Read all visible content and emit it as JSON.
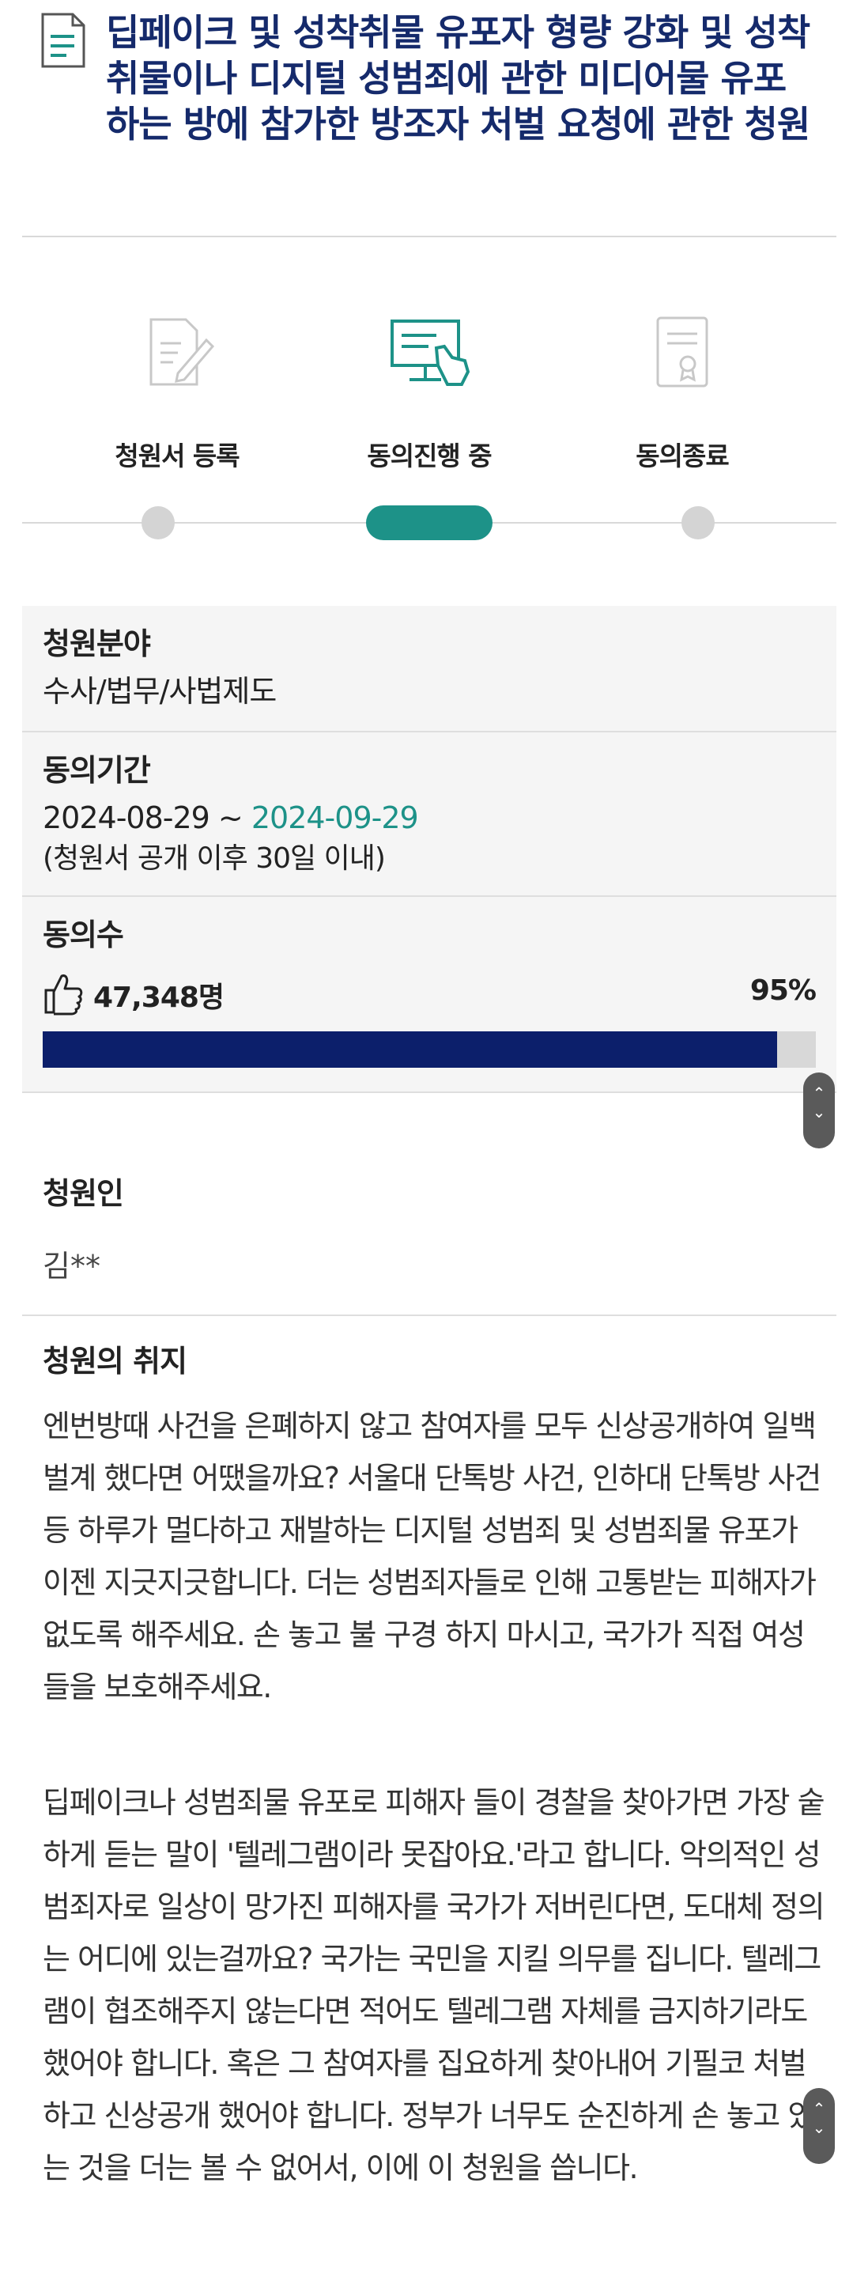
{
  "petition": {
    "title": "딥페이크 및 성착취물 유포자 형량 강화 및 성착취물이나 디지털 성범죄에 관한 미디어물 유포하는 방에 참가한 방조자 처벌 요청에 관한 청원"
  },
  "steps": [
    {
      "label": "청원서 등록",
      "icon": "pen-document-icon",
      "active": false
    },
    {
      "label": "동의진행 중",
      "icon": "monitor-hand-icon",
      "active": true
    },
    {
      "label": "동의종료",
      "icon": "certificate-icon",
      "active": false
    }
  ],
  "info": {
    "field_label": "청원분야",
    "field_value": "수사/법무/사법제도",
    "period_label": "동의기간",
    "period_start": "2024-08-29 ~ ",
    "period_end": "2024-09-29",
    "period_note": "(청원서 공개 이후 30일 이내)",
    "count_label": "동의수",
    "count_value": "47,348명",
    "percent_text": "95%",
    "progress": 0.95
  },
  "petitioner": {
    "label": "청원인",
    "name": "김**"
  },
  "purpose": {
    "label": "청원의 취지",
    "paragraph1": "엔번방때 사건을 은폐하지 않고 참여자를 모두 신상공개하여 일백벌계 했다면 어땠을까요? 서울대 단톡방 사건, 인하대 단톡방 사건등 하루가 멀다하고 재발하는 디지털 성범죄 및 성범죄물 유포가 이젠 지긋지긋합니다. 더는 성범죄자들로 인해 고통받는 피해자가 없도록 해주세요. 손 놓고 불 구경 하지 마시고, 국가가 직접 여성들을 보호해주세요.",
    "paragraph2": "딥페이크나 성범죄물 유포로 피해자 들이 경찰을 찾아가면 가장 숱하게 듣는 말이 '텔레그램이라 못잡아요.'라고 합니다. 악의적인 성범죄자로 일상이 망가진 피해자를 국가가 저버린다면, 도대체 정의는 어디에 있는걸까요? 국가는 국민을 지킬 의무를 집니다. 텔레그램이 협조해주지 않는다면 적어도 텔레그램 자체를 금지하기라도 했어야 합니다. 혹은 그 참여자를 집요하게 찾아내어 기필코 처벌하고 신상공개 했어야 합니다. 정부가 너무도 순진하게 손 놓고 있는 것을 더는 볼 수 없어서, 이에 이 청원을 씁니다."
  },
  "colors": {
    "title": "#152a6b",
    "accent": "#1d9288",
    "progress": "#0c1f6b"
  }
}
